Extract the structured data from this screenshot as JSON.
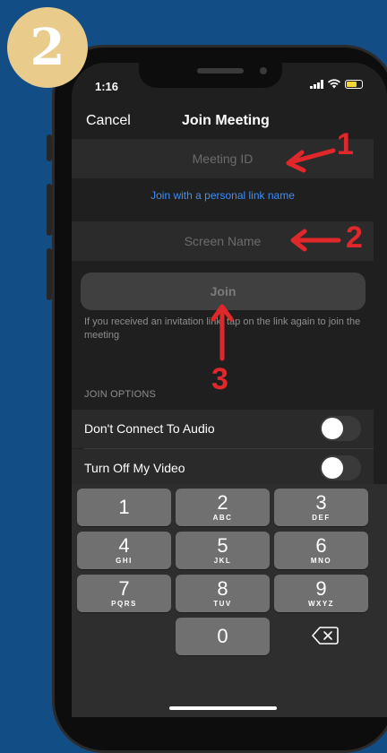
{
  "step_badge": "2",
  "status_bar": {
    "time": "1:16"
  },
  "nav": {
    "cancel": "Cancel",
    "title": "Join Meeting"
  },
  "meeting_id_field": {
    "placeholder": "Meeting ID",
    "value": ""
  },
  "personal_link": "Join with a personal link name",
  "screen_name_field": {
    "placeholder": "Screen Name",
    "value": ""
  },
  "join_button": "Join",
  "help_text": "If you received an invitation link, tap on the link again to join the meeting",
  "join_options": {
    "header": "JOIN OPTIONS",
    "items": [
      {
        "label": "Don't Connect To Audio",
        "enabled": false
      },
      {
        "label": "Turn Off My Video",
        "enabled": false
      }
    ]
  },
  "keypad": [
    {
      "digit": "1",
      "letters": ""
    },
    {
      "digit": "2",
      "letters": "ABC"
    },
    {
      "digit": "3",
      "letters": "DEF"
    },
    {
      "digit": "4",
      "letters": "GHI"
    },
    {
      "digit": "5",
      "letters": "JKL"
    },
    {
      "digit": "6",
      "letters": "MNO"
    },
    {
      "digit": "7",
      "letters": "PQRS"
    },
    {
      "digit": "8",
      "letters": "TUV"
    },
    {
      "digit": "9",
      "letters": "WXYZ"
    },
    {
      "digit": "0",
      "letters": ""
    }
  ],
  "annotations": [
    {
      "label": "1"
    },
    {
      "label": "2"
    },
    {
      "label": "3"
    }
  ],
  "colors": {
    "background": "#134d86",
    "badge": "#e9cb8c",
    "annotation": "#e0282b",
    "link": "#3f8ef5"
  }
}
